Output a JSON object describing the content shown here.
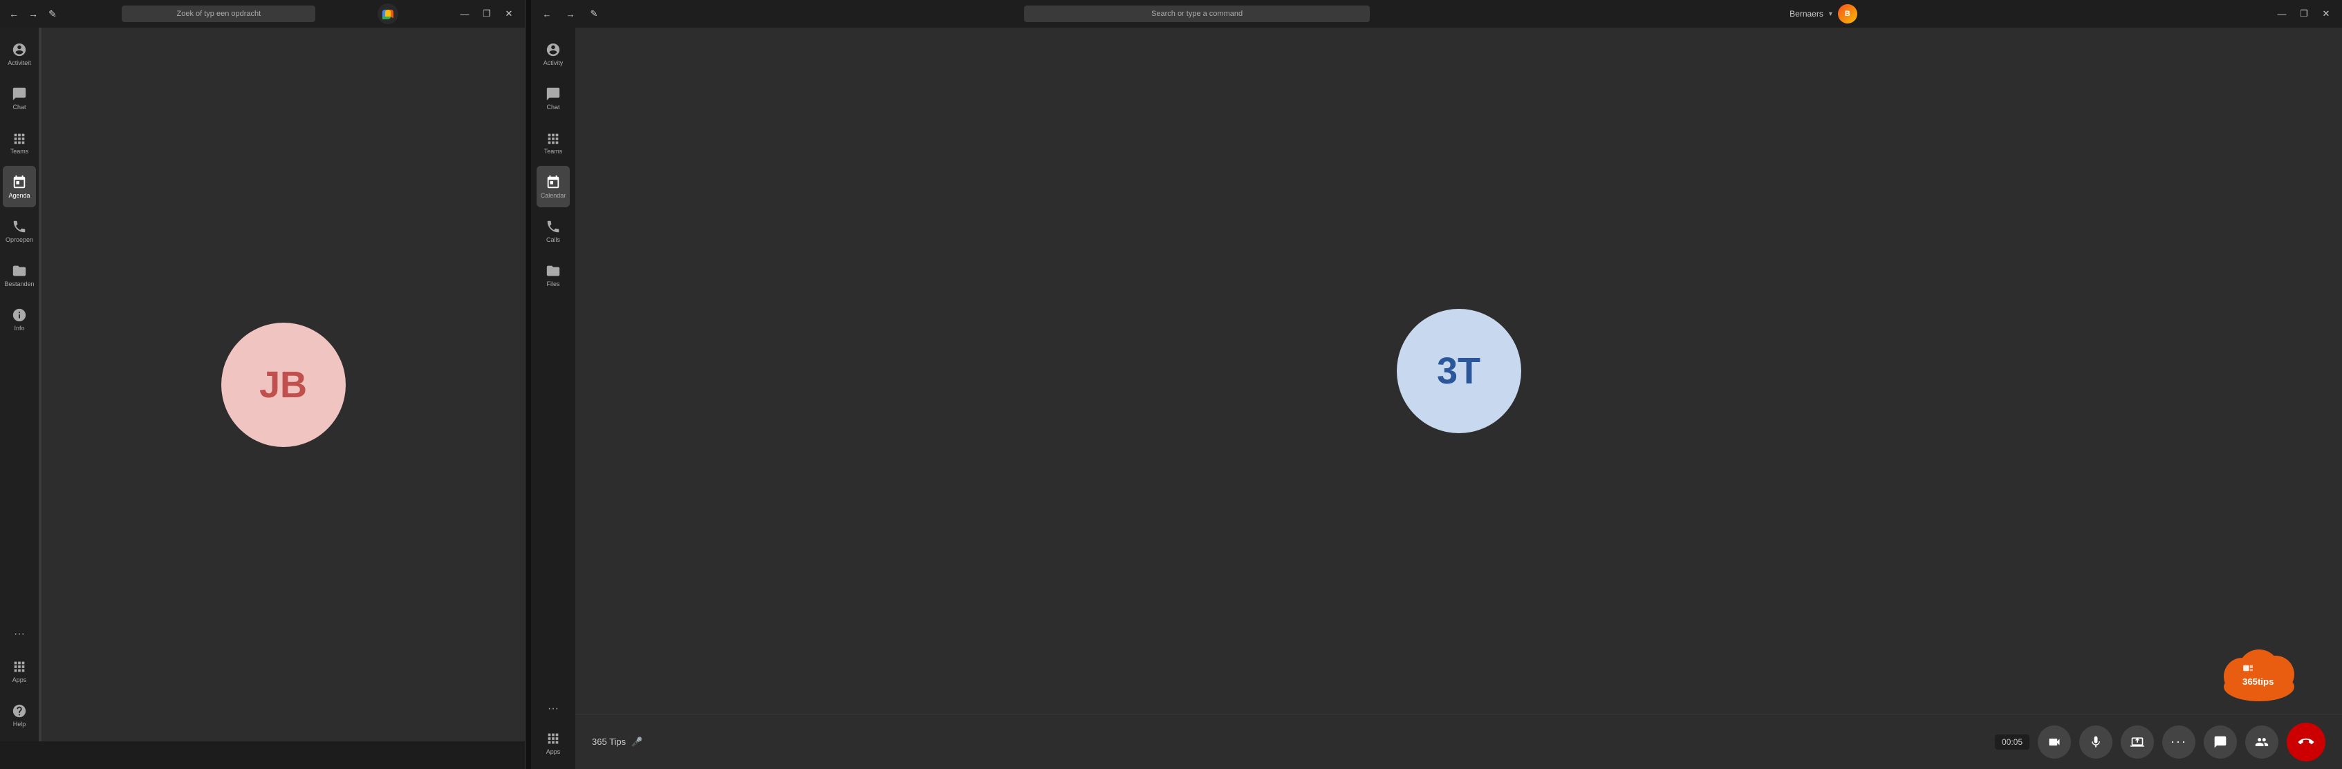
{
  "left_window": {
    "title_bar": {
      "search_placeholder": "Zoek of typ een opdracht",
      "nav_back": "←",
      "nav_forward": "→",
      "compose_icon": "✎",
      "win_minimize": "—",
      "win_maximize": "❐",
      "win_close": "✕"
    },
    "sidebar": {
      "items": [
        {
          "id": "activity",
          "label": "Activiteit",
          "icon": "bell"
        },
        {
          "id": "chat",
          "label": "Chat",
          "icon": "chat"
        },
        {
          "id": "teams",
          "label": "Teams",
          "icon": "grid"
        },
        {
          "id": "agenda",
          "label": "Agenda",
          "icon": "calendar",
          "active": true
        },
        {
          "id": "calls",
          "label": "Oproepen",
          "icon": "phone"
        },
        {
          "id": "files",
          "label": "Bestanden",
          "icon": "files"
        },
        {
          "id": "info",
          "label": "Info",
          "icon": "info"
        }
      ],
      "bottom_items": [
        {
          "id": "apps",
          "label": "Apps",
          "icon": "apps"
        },
        {
          "id": "help",
          "label": "Help",
          "icon": "help"
        }
      ],
      "more": "..."
    },
    "main": {
      "avatar_initials": "JB",
      "avatar_bg": "#f0c4c0",
      "avatar_color": "#c0504d"
    }
  },
  "right_window": {
    "title_bar": {
      "search_placeholder": "Search or type a command",
      "nav_back": "←",
      "nav_forward": "→",
      "compose_icon": "✎",
      "user_name": "Bernaers",
      "win_minimize": "—",
      "win_maximize": "❐",
      "win_close": "✕"
    },
    "sidebar": {
      "items": [
        {
          "id": "activity",
          "label": "Activity",
          "icon": "bell"
        },
        {
          "id": "chat",
          "label": "Chat",
          "icon": "chat"
        },
        {
          "id": "teams",
          "label": "Teams",
          "icon": "grid"
        },
        {
          "id": "calendar",
          "label": "Calendar",
          "icon": "calendar",
          "active": true
        },
        {
          "id": "calls",
          "label": "Calls",
          "icon": "phone"
        },
        {
          "id": "files",
          "label": "Files",
          "icon": "files"
        }
      ],
      "bottom_items": [
        {
          "id": "apps",
          "label": "Apps",
          "icon": "apps"
        }
      ],
      "more": "..."
    },
    "main": {
      "avatar_initials": "3T",
      "avatar_bg": "#c8d8ef",
      "avatar_color": "#2b579a"
    },
    "call_bar": {
      "caller": "365 Tips",
      "timer": "00:05",
      "controls": [
        {
          "id": "video",
          "icon": "📹",
          "label": "Video"
        },
        {
          "id": "mic",
          "icon": "🎤",
          "label": "Mute"
        },
        {
          "id": "share",
          "icon": "⬆",
          "label": "Share"
        },
        {
          "id": "more",
          "icon": "•••",
          "label": "More"
        },
        {
          "id": "chat",
          "icon": "💬",
          "label": "Chat"
        },
        {
          "id": "participants",
          "icon": "👥",
          "label": "Participants"
        },
        {
          "id": "end",
          "icon": "📞",
          "label": "End Call"
        }
      ]
    },
    "watermark": {
      "text": "365tips",
      "logo_color": "#e85d10"
    }
  }
}
